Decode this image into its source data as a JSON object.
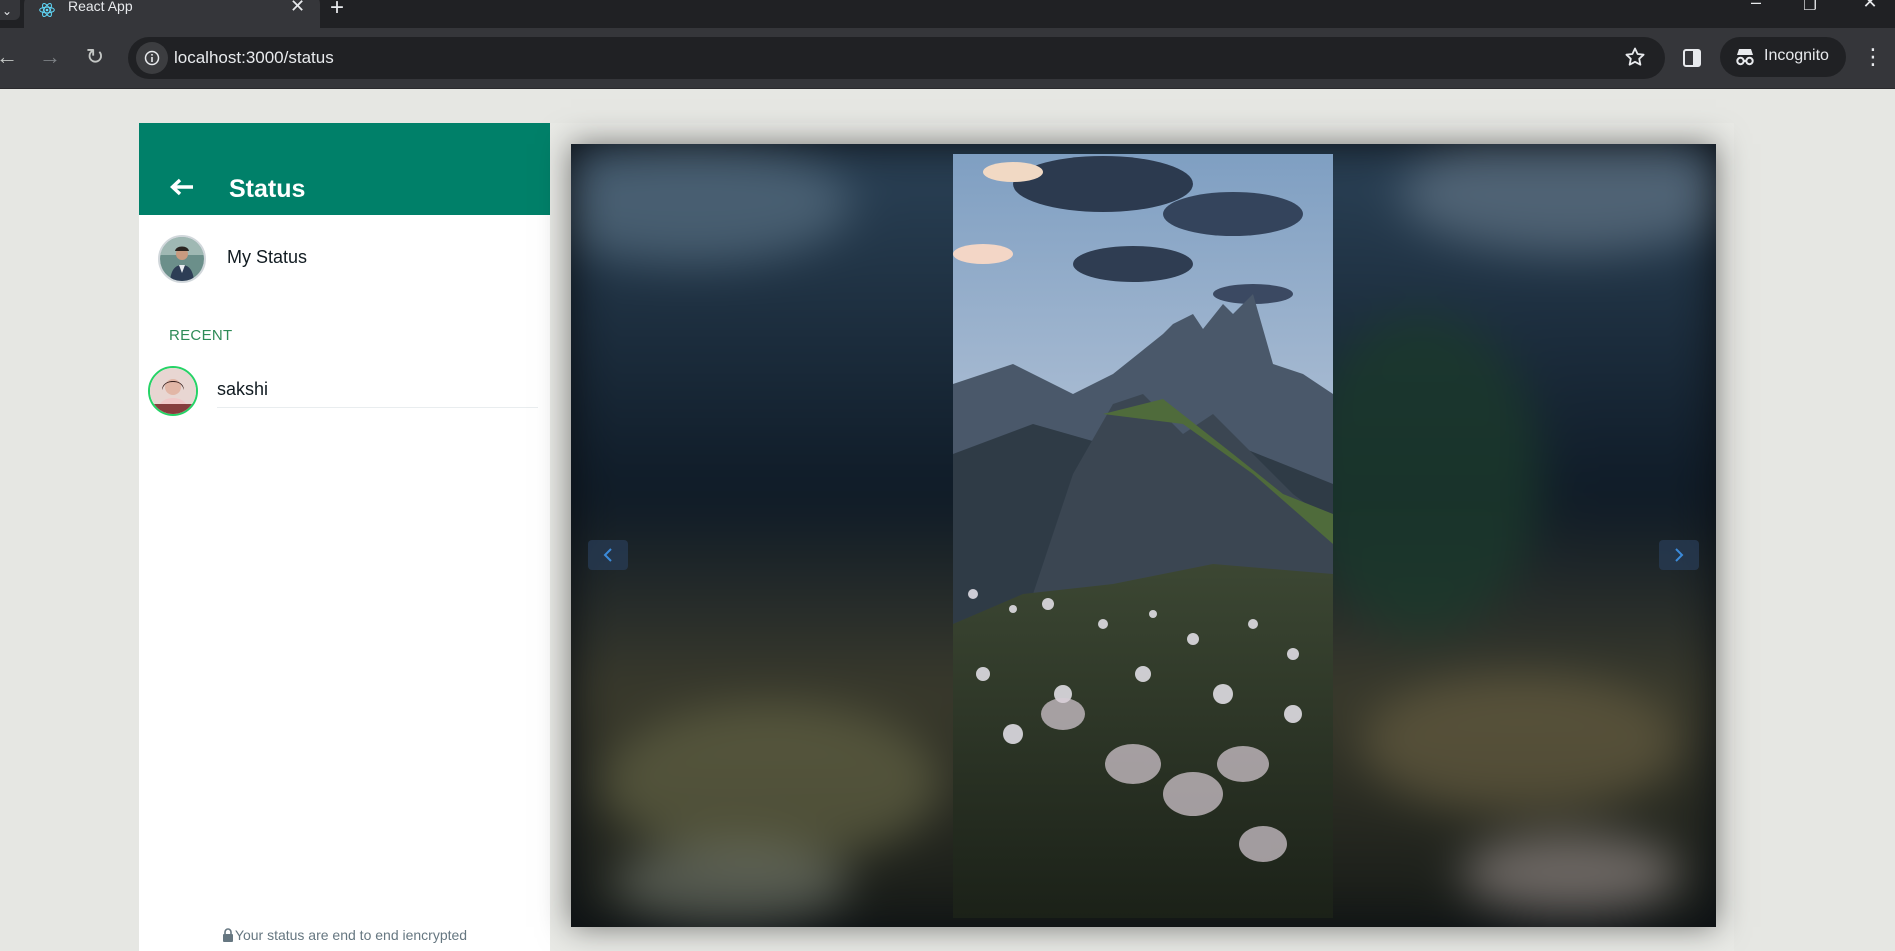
{
  "browser": {
    "tab_title": "React App",
    "url": "localhost:3000/status",
    "profile_label": "Incognito"
  },
  "sidebar": {
    "title": "Status",
    "my_status_label": "My Status",
    "recent_label": "RECENT",
    "contacts": [
      {
        "name": "sakshi"
      }
    ],
    "encryption_note": "Your status are end to end iencrypted"
  },
  "colors": {
    "header_green": "#008069",
    "recent_green": "#2e8b57",
    "page_background": "#e6e7e3"
  }
}
